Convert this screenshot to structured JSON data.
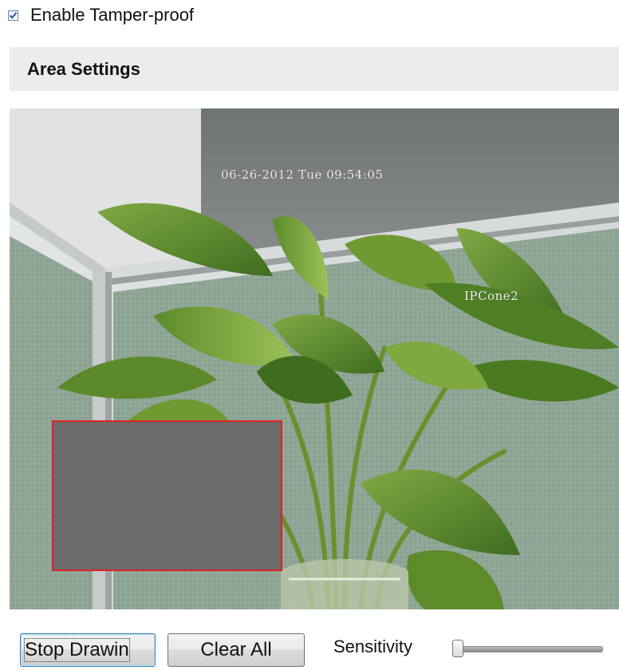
{
  "tamper": {
    "enabled": true,
    "label": "Enable Tamper-proof"
  },
  "area_settings": {
    "title": "Area Settings"
  },
  "video": {
    "osd_timestamp": "06-26-2012 Tue 09:54:05",
    "osd_camera_name": "IPCone2",
    "mask_border_color": "#e02020",
    "mask_fill_color": "#6b6b6b"
  },
  "controls": {
    "stop_drawing_label": "Stop Drawin",
    "clear_all_label": "Clear All",
    "sensitivity_label": "Sensitivity",
    "sensitivity_value": 0
  }
}
